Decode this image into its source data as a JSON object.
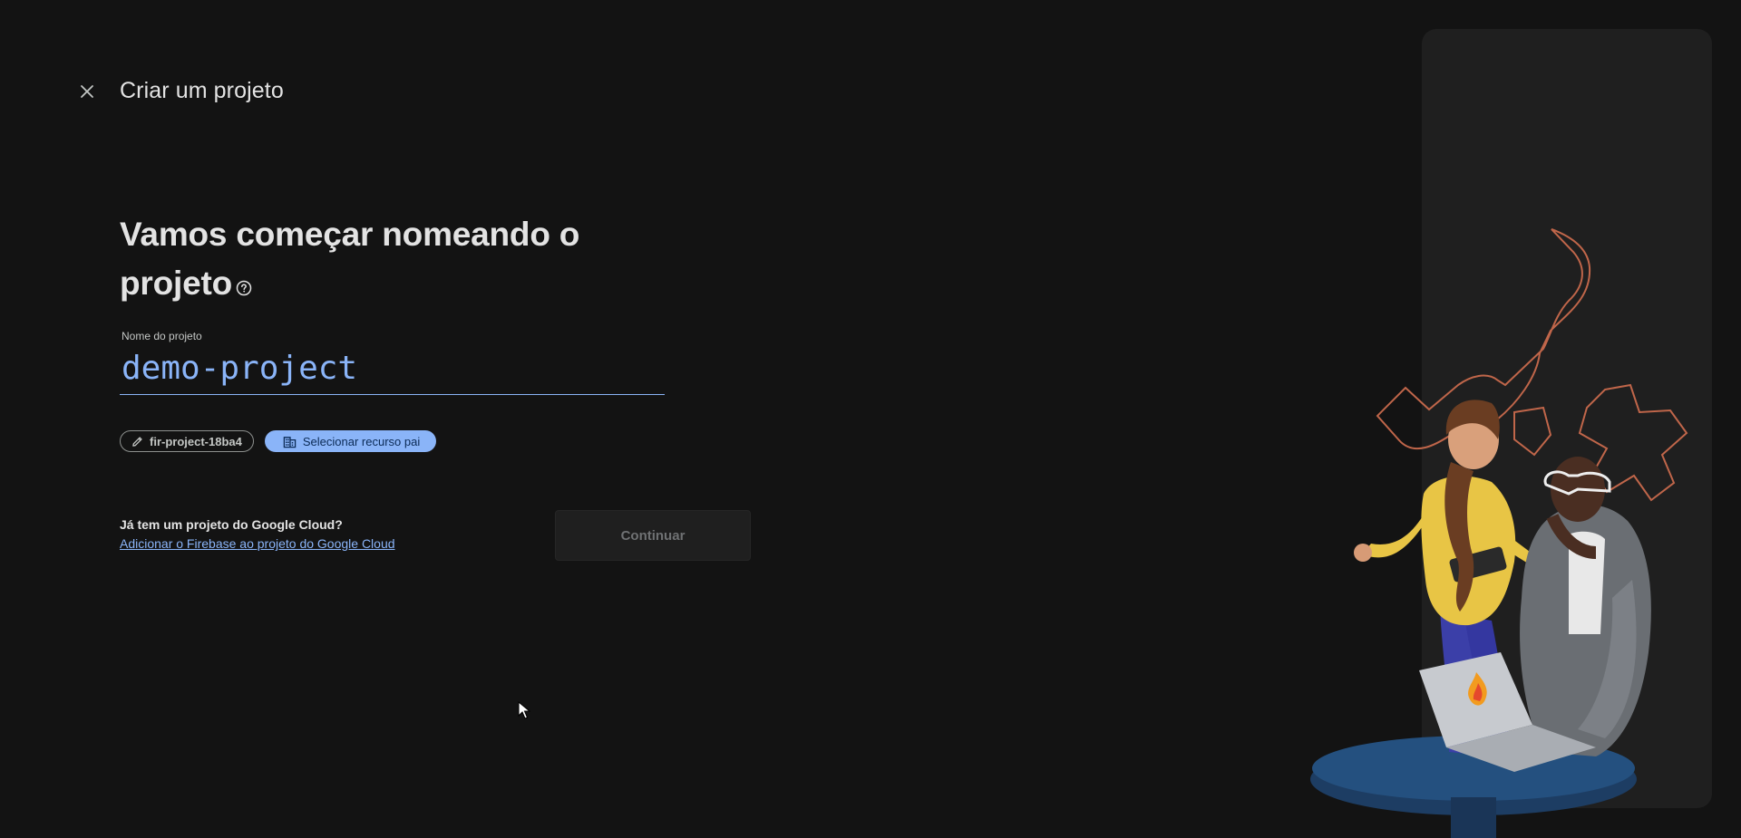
{
  "header": {
    "title": "Criar um projeto",
    "close_icon": "close-icon"
  },
  "main": {
    "heading": "Vamos começar nomeando o projeto",
    "help_icon": "help-circle-icon",
    "project_name": {
      "label": "Nome do projeto",
      "value": "demo-project"
    },
    "chips": {
      "project_id": "fir-project-18ba4",
      "project_id_icon": "pencil-icon",
      "parent_resource": "Selecionar recurso pai",
      "parent_resource_icon": "building-icon"
    },
    "google_cloud": {
      "question": "Já tem um projeto do Google Cloud?",
      "link": "Adicionar o Firebase ao projeto do Google Cloud"
    },
    "continue_label": "Continuar"
  },
  "illustration": {
    "name": "two-people-with-laptop-illustration",
    "accent_color": "#c0664a"
  },
  "colors": {
    "background": "#131313",
    "accent": "#8ab4f8",
    "panel": "#1f1f1f"
  }
}
